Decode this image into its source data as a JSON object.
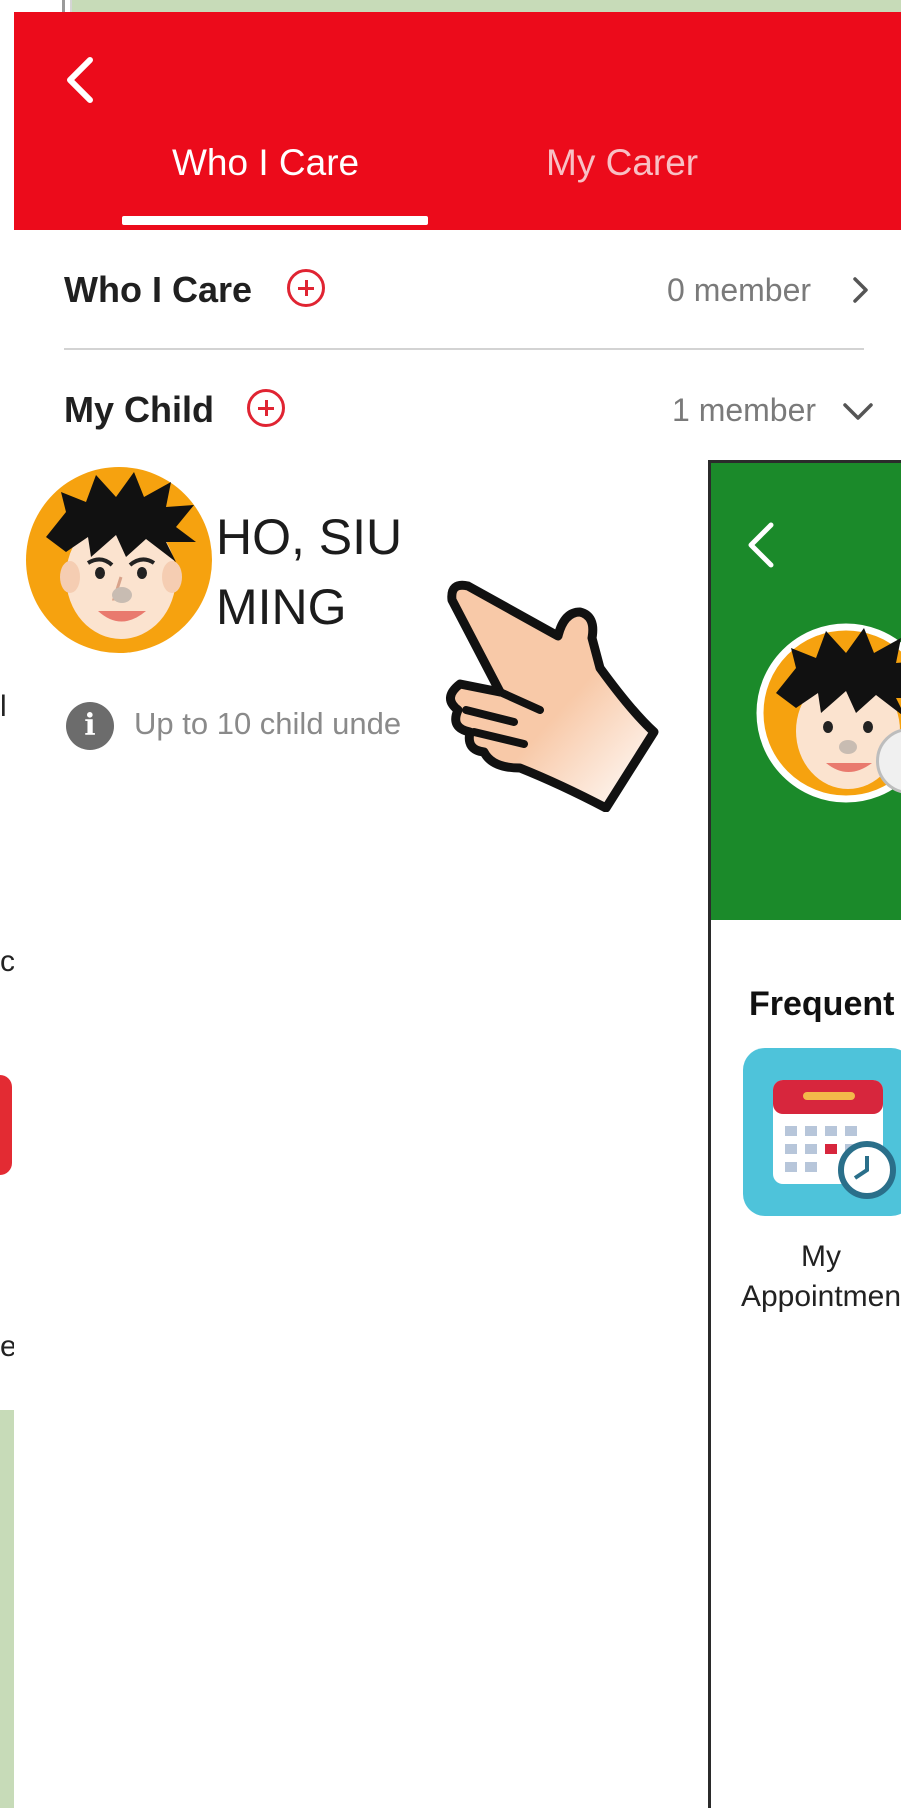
{
  "header": {
    "tabs": [
      {
        "label": "Who I Care",
        "active": true
      },
      {
        "label": "My Carer",
        "active": false
      }
    ],
    "color": "#ec0b1b"
  },
  "sections": [
    {
      "title": "Who I Care",
      "count": "0 member",
      "expanded": false
    },
    {
      "title": "My Child",
      "count": "1 member",
      "expanded": true
    }
  ],
  "child": {
    "name_line1": "HO, SIU",
    "name_line2": "MING"
  },
  "info_text": "Up to 10 child unde",
  "profile_panel": {
    "header_color": "#1b8a2a",
    "frequent_title": "Frequent",
    "shortcut_label_line1": "My",
    "shortcut_label_line2": "Appointmen"
  },
  "background_glyphs": [
    "l",
    "c",
    "e"
  ]
}
